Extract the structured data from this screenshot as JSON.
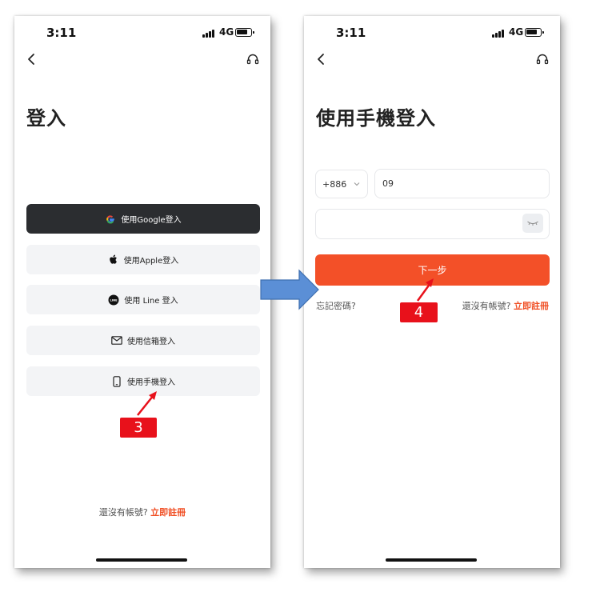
{
  "left_screen": {
    "status_bar": {
      "time": "3:11",
      "network": "4G"
    },
    "title": "登入",
    "login_options": [
      {
        "label": "使用Google登入",
        "icon": "google-icon",
        "style": "dark"
      },
      {
        "label": "使用Apple登入",
        "icon": "apple-icon",
        "style": "light"
      },
      {
        "label": "使用 Line 登入",
        "icon": "line-icon",
        "style": "light"
      },
      {
        "label": "使用信箱登入",
        "icon": "mail-icon",
        "style": "light"
      },
      {
        "label": "使用手機登入",
        "icon": "phone-icon",
        "style": "light"
      }
    ],
    "signup_prompt": "還沒有帳號?",
    "signup_link": "立即註冊"
  },
  "right_screen": {
    "status_bar": {
      "time": "3:11",
      "network": "4G"
    },
    "title": "使用手機登入",
    "country_code": "+886",
    "phone_value": "09",
    "password_value": "",
    "next_button": "下一步",
    "forgot_password": "忘記密碼?",
    "signup_prompt": "還沒有帳號?",
    "signup_link": "立即註冊"
  },
  "annotations": {
    "step_3": "3",
    "step_4": "4",
    "badge_color": "#e8111b",
    "arrow_color": "#5b8fd6"
  },
  "colors": {
    "accent": "#f35028",
    "link": "#f04e23",
    "dark_button": "#2b2d30",
    "light_button": "#f3f4f6"
  }
}
